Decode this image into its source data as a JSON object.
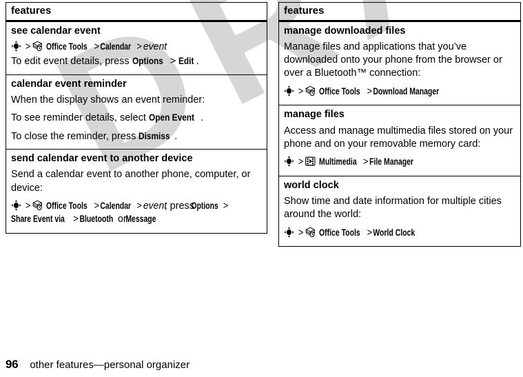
{
  "document": {
    "watermark": "DRAFT",
    "page_number": "96",
    "footer_title": "other features—personal organizer"
  },
  "icons": {
    "nav_key": "five-way-navigation-key-icon",
    "office_tools": "office-tools-icon",
    "multimedia": "multimedia-icon"
  },
  "columns": [
    {
      "id": "left",
      "header": "features",
      "rows": [
        {
          "title": "see calendar event",
          "blocks": [
            {
              "type": "path",
              "icon": "nav_key",
              "parts": [
                {
                  "kind": "sep",
                  "text": ">"
                },
                {
                  "kind": "appicon",
                  "icon": "office_tools"
                },
                {
                  "kind": "bold",
                  "text": "Office Tools"
                },
                {
                  "kind": "sep",
                  "text": ">"
                },
                {
                  "kind": "bold",
                  "text": "Calendar"
                },
                {
                  "kind": "sep",
                  "text": ">"
                },
                {
                  "kind": "italic",
                  "text": "event"
                }
              ]
            },
            {
              "type": "para",
              "parts": [
                {
                  "kind": "plain",
                  "text": "To edit event details, press "
                },
                {
                  "kind": "bold",
                  "text": "Options"
                },
                {
                  "kind": "sep",
                  "text": " > "
                },
                {
                  "kind": "bold",
                  "text": "Edit"
                },
                {
                  "kind": "plain",
                  "text": "."
                }
              ]
            }
          ]
        },
        {
          "title": "calendar event reminder",
          "blocks": [
            {
              "type": "para",
              "parts": [
                {
                  "kind": "plain",
                  "text": "When the display shows an event reminder:"
                }
              ]
            },
            {
              "type": "para",
              "parts": [
                {
                  "kind": "plain",
                  "text": "To see reminder details, select "
                },
                {
                  "kind": "bold",
                  "text": "Open Event"
                },
                {
                  "kind": "plain",
                  "text": "."
                }
              ]
            },
            {
              "type": "para",
              "parts": [
                {
                  "kind": "plain",
                  "text": "To close the reminder, press "
                },
                {
                  "kind": "bold",
                  "text": "Dismiss"
                },
                {
                  "kind": "plain",
                  "text": "."
                }
              ]
            }
          ]
        },
        {
          "title": "send calendar event to another device",
          "blocks": [
            {
              "type": "para",
              "parts": [
                {
                  "kind": "plain",
                  "text": "Send a calendar event to another phone, computer, or device:"
                }
              ]
            },
            {
              "type": "path",
              "icon": "nav_key",
              "parts": [
                {
                  "kind": "sep",
                  "text": ">"
                },
                {
                  "kind": "appicon",
                  "icon": "office_tools"
                },
                {
                  "kind": "bold",
                  "text": "Office Tools"
                },
                {
                  "kind": "sep",
                  "text": ">"
                },
                {
                  "kind": "bold",
                  "text": "Calendar"
                },
                {
                  "kind": "sep",
                  "text": ">"
                },
                {
                  "kind": "italic",
                  "text": "event"
                },
                {
                  "kind": "plain",
                  "text": ", press "
                },
                {
                  "kind": "bold",
                  "text": "Options"
                },
                {
                  "kind": "sep",
                  "text": ">"
                },
                {
                  "kind": "bold",
                  "text": "Share Event via"
                },
                {
                  "kind": "sep",
                  "text": ">"
                },
                {
                  "kind": "bold",
                  "text": "Bluetooth"
                },
                {
                  "kind": "plain",
                  "text": " or "
                },
                {
                  "kind": "bold",
                  "text": "Message"
                }
              ]
            }
          ]
        }
      ]
    },
    {
      "id": "right",
      "header": "features",
      "rows": [
        {
          "title": "manage downloaded files",
          "blocks": [
            {
              "type": "para",
              "parts": [
                {
                  "kind": "plain",
                  "text": "Manage files and applications that you’ve downloaded onto your phone from the browser or over a Bluetooth™ connection:"
                }
              ]
            },
            {
              "type": "path",
              "icon": "nav_key",
              "parts": [
                {
                  "kind": "sep",
                  "text": ">"
                },
                {
                  "kind": "appicon",
                  "icon": "office_tools"
                },
                {
                  "kind": "bold",
                  "text": "Office Tools"
                },
                {
                  "kind": "sep",
                  "text": ">"
                },
                {
                  "kind": "bold",
                  "text": "Download Manager"
                }
              ]
            }
          ]
        },
        {
          "title": "manage files",
          "blocks": [
            {
              "type": "para",
              "parts": [
                {
                  "kind": "plain",
                  "text": "Access and manage multimedia files stored on your phone and on your removable memory card:"
                }
              ]
            },
            {
              "type": "path",
              "icon": "nav_key",
              "parts": [
                {
                  "kind": "sep",
                  "text": ">"
                },
                {
                  "kind": "appicon",
                  "icon": "multimedia"
                },
                {
                  "kind": "bold",
                  "text": "Multimedia"
                },
                {
                  "kind": "sep",
                  "text": ">"
                },
                {
                  "kind": "bold",
                  "text": "File Manager"
                }
              ]
            }
          ]
        },
        {
          "title": "world clock",
          "blocks": [
            {
              "type": "para",
              "parts": [
                {
                  "kind": "plain",
                  "text": "Show time and date information for multiple cities around the world:"
                }
              ]
            },
            {
              "type": "path",
              "icon": "nav_key",
              "parts": [
                {
                  "kind": "sep",
                  "text": ">"
                },
                {
                  "kind": "appicon",
                  "icon": "office_tools"
                },
                {
                  "kind": "bold",
                  "text": "Office Tools"
                },
                {
                  "kind": "sep",
                  "text": ">"
                },
                {
                  "kind": "bold",
                  "text": "World Clock"
                }
              ]
            }
          ]
        }
      ]
    }
  ]
}
